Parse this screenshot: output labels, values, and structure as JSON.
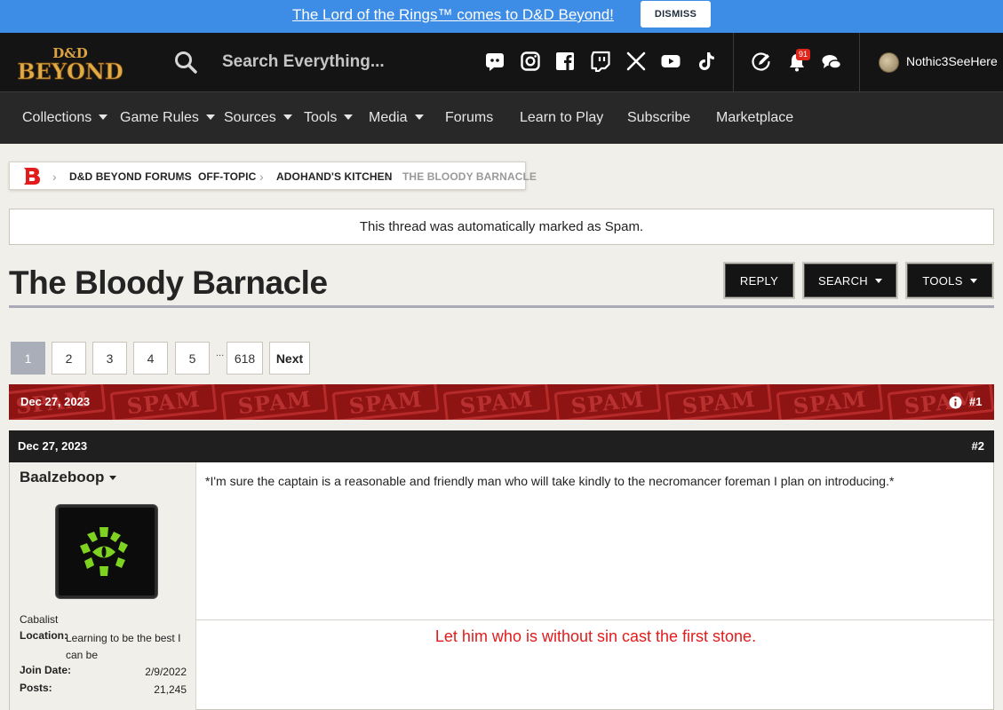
{
  "banner": {
    "link_text": "The Lord of the Rings™ comes to D&D Beyond!",
    "dismiss_label": "DISMISS"
  },
  "header": {
    "logo_top": "D&D",
    "logo_bottom": "BEYOND",
    "search_placeholder": "Search Everything...",
    "social_icons": [
      "discord-icon",
      "instagram-icon",
      "facebook-icon",
      "twitch-icon",
      "x-icon",
      "youtube-icon",
      "tiktok-icon"
    ],
    "notification_count": "91",
    "username": "Nothic3SeeHere"
  },
  "nav": {
    "items": [
      {
        "label": "Collections",
        "dropdown": true
      },
      {
        "label": "Game Rules",
        "dropdown": true
      },
      {
        "label": "Sources",
        "dropdown": true
      },
      {
        "label": "Tools",
        "dropdown": true
      },
      {
        "label": "Media",
        "dropdown": true
      },
      {
        "label": "Forums",
        "dropdown": false
      },
      {
        "label": "Learn to Play",
        "dropdown": false
      },
      {
        "label": "Subscribe",
        "dropdown": false
      },
      {
        "label": "Marketplace",
        "dropdown": false
      }
    ]
  },
  "breadcrumb": {
    "items": [
      "D&D BEYOND FORUMS",
      "OFF-TOPIC",
      "ADOHAND'S KITCHEN",
      "THE BLOODY BARNACLE"
    ]
  },
  "notice": "This thread was automatically marked as Spam.",
  "thread": {
    "title": "The Bloody Barnacle",
    "actions": {
      "reply": "REPLY",
      "search": "SEARCH",
      "tools": "TOOLS"
    }
  },
  "pagination": {
    "pages": [
      "1",
      "2",
      "3",
      "4",
      "5"
    ],
    "ellipsis": "...",
    "last": "618",
    "next": "Next",
    "current": "1"
  },
  "spam_post": {
    "date": "Dec 27, 2023",
    "number": "#1",
    "stamp_text": "SPAM"
  },
  "post": {
    "date": "Dec 27, 2023",
    "number": "#2",
    "author": {
      "name": "Baalzeboop",
      "rank": "Cabalist",
      "location_label": "Location:",
      "location": "Learning to be the best I can be",
      "join_label": "Join Date:",
      "join_date": "2/9/2022",
      "posts_label": "Posts:",
      "posts": "21,245"
    },
    "body": "*I'm sure the captain is a reasonable and friendly man who will take kindly to the necromancer foreman I plan on introducing.*",
    "signature": "Let him who is without sin cast the first stone."
  },
  "colors": {
    "banner": "#3d8ce6",
    "header": "#141414",
    "nav": "#282828",
    "brand_red": "#e21c1c",
    "spam_bar": "#8e1414",
    "avatar_eye": "#7ed321"
  }
}
